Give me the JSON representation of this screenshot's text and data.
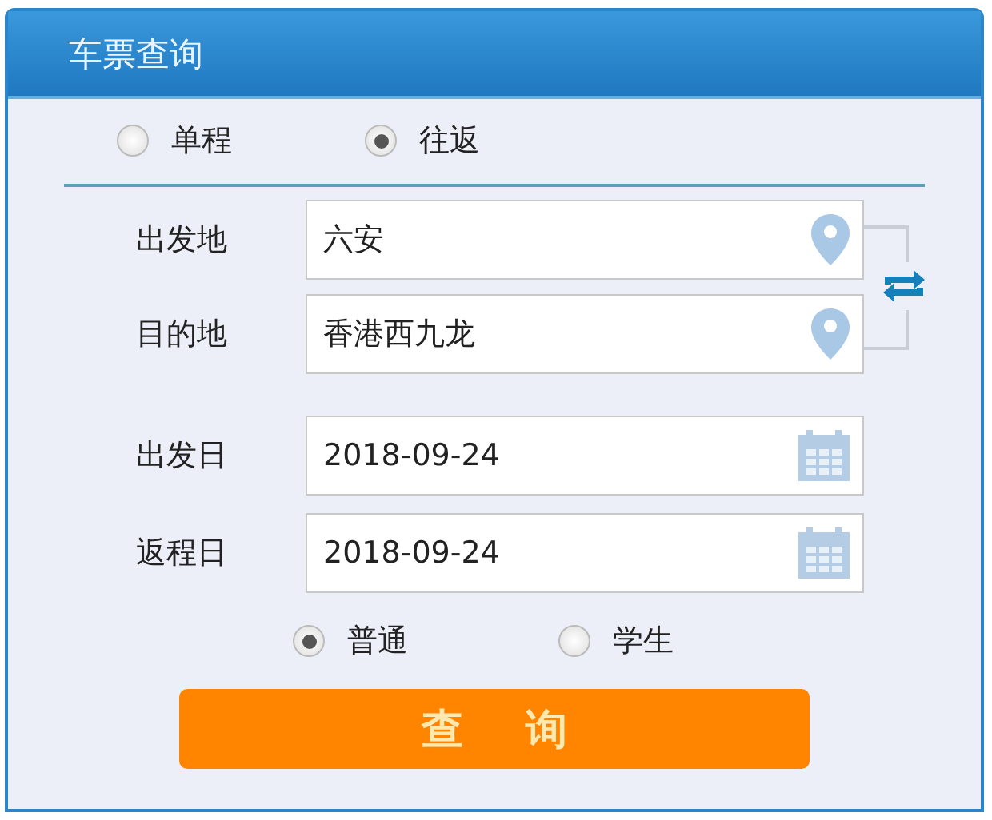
{
  "panel": {
    "title": "车票查询"
  },
  "trip_types": [
    {
      "label": "单程",
      "selected": false
    },
    {
      "label": "往返",
      "selected": true
    }
  ],
  "locations": [
    {
      "label": "出发地",
      "value": "六安"
    },
    {
      "label": "目的地",
      "value": "香港西九龙"
    }
  ],
  "dates": [
    {
      "label": "出发日",
      "value": "2018-09-24"
    },
    {
      "label": "返程日",
      "value": "2018-09-24"
    }
  ],
  "ticket_types": [
    {
      "label": "普通",
      "selected": true
    },
    {
      "label": "学生",
      "selected": false
    }
  ],
  "search_button": "查 询"
}
